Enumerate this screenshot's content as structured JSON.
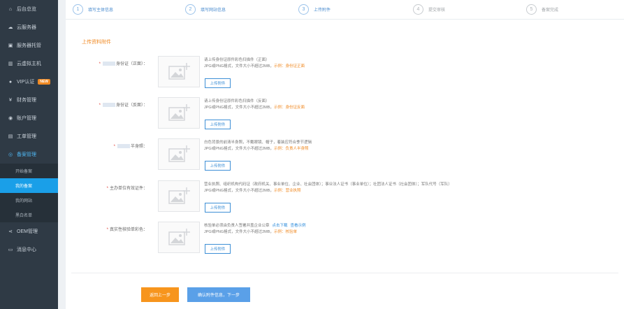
{
  "sidebar": {
    "items": [
      {
        "icon": "home-icon",
        "glyph": "⌂",
        "label": "后台总览"
      },
      {
        "icon": "cloud-icon",
        "glyph": "☁",
        "label": "云服务器"
      },
      {
        "icon": "server-icon",
        "glyph": "▣",
        "label": "服务器托管"
      },
      {
        "icon": "cabinet-icon",
        "glyph": "▥",
        "label": "云虚拟主机"
      },
      {
        "icon": "user-icon",
        "glyph": "●",
        "label": "VIP认证",
        "badge": "NEW"
      },
      {
        "icon": "yen-icon",
        "glyph": "¥",
        "label": "财务管理"
      },
      {
        "icon": "account-icon",
        "glyph": "◉",
        "label": "账户管理"
      },
      {
        "icon": "ticket-icon",
        "glyph": "▤",
        "label": "工单管理"
      },
      {
        "icon": "filing-icon",
        "glyph": "◎",
        "label": "备案管理"
      },
      {
        "icon": "share-icon",
        "glyph": "⋖",
        "label": "OEM管理"
      },
      {
        "icon": "message-icon",
        "glyph": "▭",
        "label": "消息中心"
      }
    ],
    "sub_items": [
      {
        "label": "开始备案"
      },
      {
        "label": "我的备案"
      },
      {
        "label": "我的网站"
      },
      {
        "label": "黑白名单"
      }
    ]
  },
  "steps": [
    {
      "num": "1",
      "label": "填写主体信息"
    },
    {
      "num": "2",
      "label": "填写网站信息"
    },
    {
      "num": "3",
      "label": "上传附件"
    },
    {
      "num": "4",
      "label": "提交审核"
    },
    {
      "num": "5",
      "label": "备案完成"
    }
  ],
  "section_title": "上传资料附件",
  "rows": [
    {
      "label_suffix": "身份证（正面）：",
      "line1": "请上传身份证原件彩色扫描件（正面）",
      "line2": "JPG或PNG格式，文件大小不超过2MB，",
      "example": "示例：身份证正面",
      "button": "上传附件"
    },
    {
      "label_suffix": "身份证（反面）：",
      "line1": "请上传身份证原件彩色扫描件（反面）",
      "line2": "JPG或PNG格式，文件大小不超过2MB，",
      "example": "示例：身份证反面",
      "button": "上传附件"
    },
    {
      "label_suffix": "半身照：",
      "line1": "白色背景的前清半身照，不戴眼镜、帽子，着装应符合季节逻辑",
      "line2": "JPG或PNG格式，文件大小不超过2MB，",
      "example": "示例：负责人半身照",
      "button": "上传附件"
    },
    {
      "label_suffix": "主办单位有效证件：",
      "line1": "营业执照、组织机构代码证（政府机关、事业单位、企业、社会团体）；事业法人证书（事业单位）；社团法人证书（社会团体）；军队代号（军队）",
      "line2": "JPG或PNG格式，文件大小不超过2MB，",
      "example": "示例：营业执照",
      "button": "上传附件"
    },
    {
      "label_suffix": "真实性核验单彩色：",
      "line1": "核验单必须由负责人签署并盖企业公章",
      "link1": "点击下载",
      "link2": "查看示例",
      "line2": "JPG或PNG格式，文件大小不超过2MB，",
      "example": "示例：核验单",
      "button": "上传附件"
    }
  ],
  "buttons": {
    "back": "返回上一步",
    "next": "确认附件信息，下一步"
  }
}
